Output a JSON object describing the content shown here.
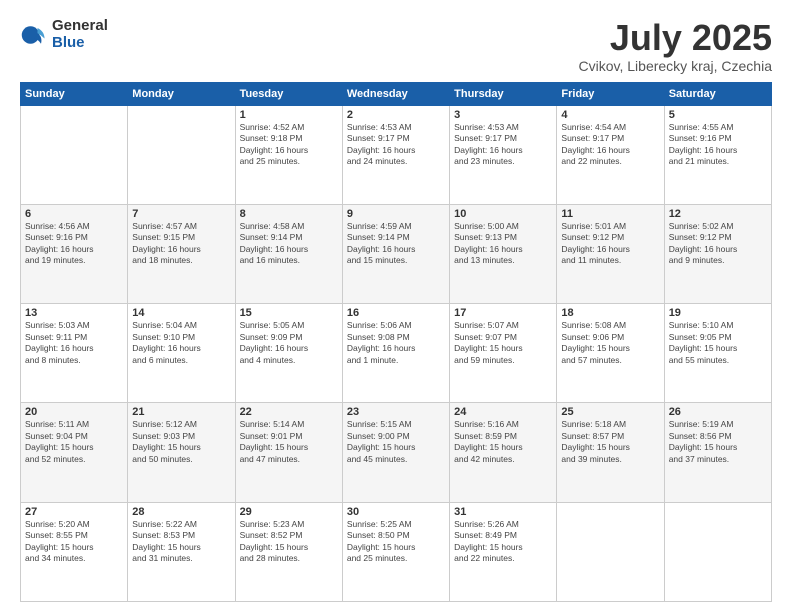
{
  "logo": {
    "general": "General",
    "blue": "Blue"
  },
  "title": {
    "month": "July 2025",
    "location": "Cvikov, Liberecky kraj, Czechia"
  },
  "weekdays": [
    "Sunday",
    "Monday",
    "Tuesday",
    "Wednesday",
    "Thursday",
    "Friday",
    "Saturday"
  ],
  "weeks": [
    [
      {
        "day": "",
        "detail": ""
      },
      {
        "day": "",
        "detail": ""
      },
      {
        "day": "1",
        "detail": "Sunrise: 4:52 AM\nSunset: 9:18 PM\nDaylight: 16 hours\nand 25 minutes."
      },
      {
        "day": "2",
        "detail": "Sunrise: 4:53 AM\nSunset: 9:17 PM\nDaylight: 16 hours\nand 24 minutes."
      },
      {
        "day": "3",
        "detail": "Sunrise: 4:53 AM\nSunset: 9:17 PM\nDaylight: 16 hours\nand 23 minutes."
      },
      {
        "day": "4",
        "detail": "Sunrise: 4:54 AM\nSunset: 9:17 PM\nDaylight: 16 hours\nand 22 minutes."
      },
      {
        "day": "5",
        "detail": "Sunrise: 4:55 AM\nSunset: 9:16 PM\nDaylight: 16 hours\nand 21 minutes."
      }
    ],
    [
      {
        "day": "6",
        "detail": "Sunrise: 4:56 AM\nSunset: 9:16 PM\nDaylight: 16 hours\nand 19 minutes."
      },
      {
        "day": "7",
        "detail": "Sunrise: 4:57 AM\nSunset: 9:15 PM\nDaylight: 16 hours\nand 18 minutes."
      },
      {
        "day": "8",
        "detail": "Sunrise: 4:58 AM\nSunset: 9:14 PM\nDaylight: 16 hours\nand 16 minutes."
      },
      {
        "day": "9",
        "detail": "Sunrise: 4:59 AM\nSunset: 9:14 PM\nDaylight: 16 hours\nand 15 minutes."
      },
      {
        "day": "10",
        "detail": "Sunrise: 5:00 AM\nSunset: 9:13 PM\nDaylight: 16 hours\nand 13 minutes."
      },
      {
        "day": "11",
        "detail": "Sunrise: 5:01 AM\nSunset: 9:12 PM\nDaylight: 16 hours\nand 11 minutes."
      },
      {
        "day": "12",
        "detail": "Sunrise: 5:02 AM\nSunset: 9:12 PM\nDaylight: 16 hours\nand 9 minutes."
      }
    ],
    [
      {
        "day": "13",
        "detail": "Sunrise: 5:03 AM\nSunset: 9:11 PM\nDaylight: 16 hours\nand 8 minutes."
      },
      {
        "day": "14",
        "detail": "Sunrise: 5:04 AM\nSunset: 9:10 PM\nDaylight: 16 hours\nand 6 minutes."
      },
      {
        "day": "15",
        "detail": "Sunrise: 5:05 AM\nSunset: 9:09 PM\nDaylight: 16 hours\nand 4 minutes."
      },
      {
        "day": "16",
        "detail": "Sunrise: 5:06 AM\nSunset: 9:08 PM\nDaylight: 16 hours\nand 1 minute."
      },
      {
        "day": "17",
        "detail": "Sunrise: 5:07 AM\nSunset: 9:07 PM\nDaylight: 15 hours\nand 59 minutes."
      },
      {
        "day": "18",
        "detail": "Sunrise: 5:08 AM\nSunset: 9:06 PM\nDaylight: 15 hours\nand 57 minutes."
      },
      {
        "day": "19",
        "detail": "Sunrise: 5:10 AM\nSunset: 9:05 PM\nDaylight: 15 hours\nand 55 minutes."
      }
    ],
    [
      {
        "day": "20",
        "detail": "Sunrise: 5:11 AM\nSunset: 9:04 PM\nDaylight: 15 hours\nand 52 minutes."
      },
      {
        "day": "21",
        "detail": "Sunrise: 5:12 AM\nSunset: 9:03 PM\nDaylight: 15 hours\nand 50 minutes."
      },
      {
        "day": "22",
        "detail": "Sunrise: 5:14 AM\nSunset: 9:01 PM\nDaylight: 15 hours\nand 47 minutes."
      },
      {
        "day": "23",
        "detail": "Sunrise: 5:15 AM\nSunset: 9:00 PM\nDaylight: 15 hours\nand 45 minutes."
      },
      {
        "day": "24",
        "detail": "Sunrise: 5:16 AM\nSunset: 8:59 PM\nDaylight: 15 hours\nand 42 minutes."
      },
      {
        "day": "25",
        "detail": "Sunrise: 5:18 AM\nSunset: 8:57 PM\nDaylight: 15 hours\nand 39 minutes."
      },
      {
        "day": "26",
        "detail": "Sunrise: 5:19 AM\nSunset: 8:56 PM\nDaylight: 15 hours\nand 37 minutes."
      }
    ],
    [
      {
        "day": "27",
        "detail": "Sunrise: 5:20 AM\nSunset: 8:55 PM\nDaylight: 15 hours\nand 34 minutes."
      },
      {
        "day": "28",
        "detail": "Sunrise: 5:22 AM\nSunset: 8:53 PM\nDaylight: 15 hours\nand 31 minutes."
      },
      {
        "day": "29",
        "detail": "Sunrise: 5:23 AM\nSunset: 8:52 PM\nDaylight: 15 hours\nand 28 minutes."
      },
      {
        "day": "30",
        "detail": "Sunrise: 5:25 AM\nSunset: 8:50 PM\nDaylight: 15 hours\nand 25 minutes."
      },
      {
        "day": "31",
        "detail": "Sunrise: 5:26 AM\nSunset: 8:49 PM\nDaylight: 15 hours\nand 22 minutes."
      },
      {
        "day": "",
        "detail": ""
      },
      {
        "day": "",
        "detail": ""
      }
    ]
  ]
}
